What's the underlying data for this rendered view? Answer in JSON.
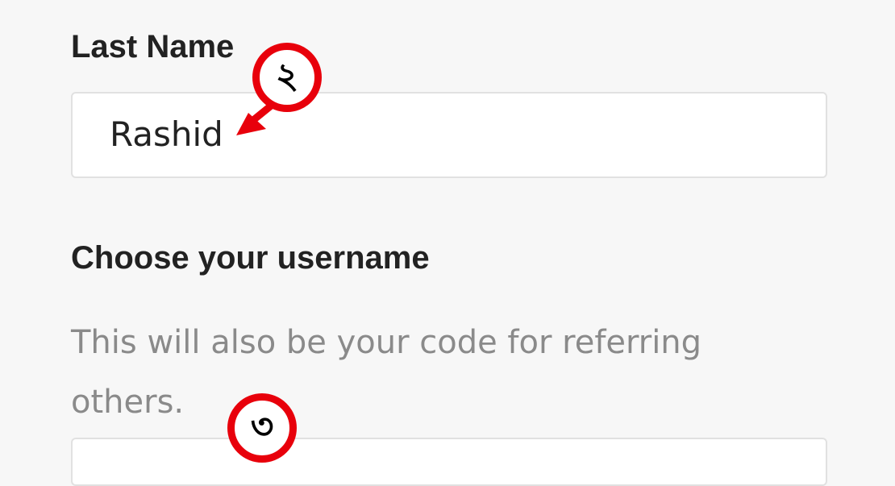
{
  "form": {
    "last_name": {
      "label": "Last Name",
      "value": "Rashid"
    },
    "username": {
      "label": "Choose your username",
      "helper": "This will also be your code for referring others."
    }
  },
  "annotations": {
    "marker_1": "২",
    "marker_2": "৩",
    "color": "#e8000b"
  }
}
